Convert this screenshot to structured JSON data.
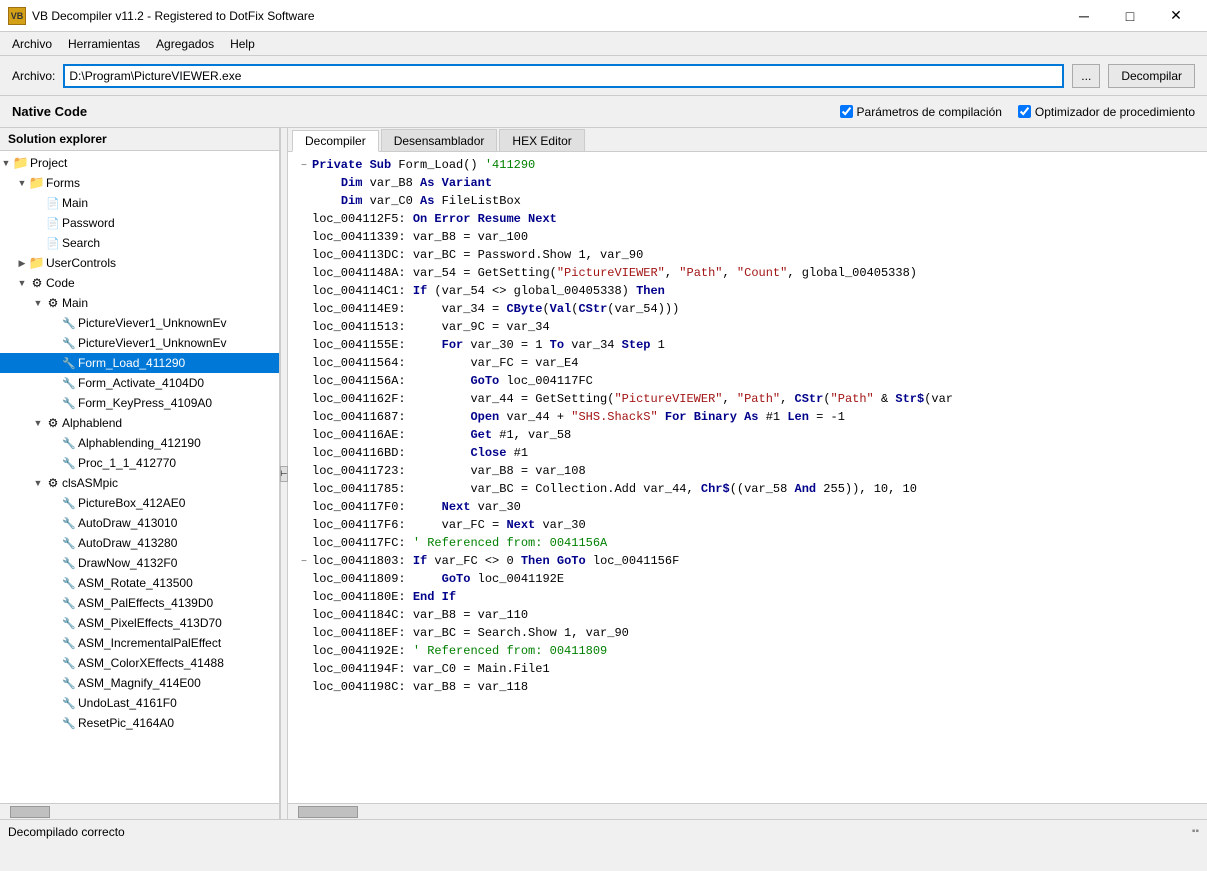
{
  "titlebar": {
    "icon_label": "VB",
    "title": "VB Decompiler v11.2 - Registered to DotFix Software",
    "minimize": "─",
    "maximize": "□",
    "close": "✕"
  },
  "menubar": {
    "items": [
      "Archivo",
      "Herramientas",
      "Agregados",
      "Help"
    ]
  },
  "toolbar": {
    "label": "Archivo:",
    "filepath": "D:\\Program\\PictureVIEWER.exe",
    "browse_label": "...",
    "decompile_label": "Decompilar"
  },
  "header": {
    "native_code": "Native Code",
    "checkbox1_label": "Parámetros de compilación",
    "checkbox2_label": "Optimizador de procedimiento"
  },
  "solution_explorer": {
    "title": "Solution explorer",
    "tree": [
      {
        "id": "project",
        "level": 0,
        "expanded": true,
        "icon": "📁",
        "label": "Project",
        "type": "folder"
      },
      {
        "id": "forms",
        "level": 1,
        "expanded": true,
        "icon": "📁",
        "label": "Forms",
        "type": "folder"
      },
      {
        "id": "main",
        "level": 2,
        "expanded": false,
        "icon": "📄",
        "label": "Main",
        "type": "file"
      },
      {
        "id": "password",
        "level": 2,
        "expanded": false,
        "icon": "📄",
        "label": "Password",
        "type": "file"
      },
      {
        "id": "search",
        "level": 2,
        "expanded": false,
        "icon": "📄",
        "label": "Search",
        "type": "file"
      },
      {
        "id": "usercontrols",
        "level": 1,
        "expanded": false,
        "icon": "📁",
        "label": "UserControls",
        "type": "folder"
      },
      {
        "id": "code",
        "level": 1,
        "expanded": true,
        "icon": "⚙",
        "label": "Code",
        "type": "code-folder"
      },
      {
        "id": "main2",
        "level": 2,
        "expanded": true,
        "icon": "⚙",
        "label": "Main",
        "type": "code-folder"
      },
      {
        "id": "picviewerunk1",
        "level": 3,
        "expanded": false,
        "icon": "🔧",
        "label": "PictureViever1_UnknownEv",
        "type": "method",
        "selected": false
      },
      {
        "id": "picviewerunk2",
        "level": 3,
        "expanded": false,
        "icon": "🔧",
        "label": "PictureViever1_UnknownEv",
        "type": "method",
        "selected": false
      },
      {
        "id": "formload",
        "level": 3,
        "expanded": false,
        "icon": "🔧",
        "label": "Form_Load_411290",
        "type": "method",
        "selected": true
      },
      {
        "id": "formactivate",
        "level": 3,
        "expanded": false,
        "icon": "🔧",
        "label": "Form_Activate_4104D0",
        "type": "method",
        "selected": false
      },
      {
        "id": "formkeypress",
        "level": 3,
        "expanded": false,
        "icon": "🔧",
        "label": "Form_KeyPress_4109A0",
        "type": "method",
        "selected": false
      },
      {
        "id": "alphablend",
        "level": 2,
        "expanded": true,
        "icon": "⚙",
        "label": "Alphablend",
        "type": "code-folder"
      },
      {
        "id": "alphablending",
        "level": 3,
        "expanded": false,
        "icon": "🔧",
        "label": "Alphablending_412190",
        "type": "method",
        "selected": false
      },
      {
        "id": "proc11",
        "level": 3,
        "expanded": false,
        "icon": "🔧",
        "label": "Proc_1_1_412770",
        "type": "method",
        "selected": false
      },
      {
        "id": "clsasmpic",
        "level": 2,
        "expanded": true,
        "icon": "⚙",
        "label": "clsASMpic",
        "type": "code-folder"
      },
      {
        "id": "picturebox",
        "level": 3,
        "expanded": false,
        "icon": "🔧",
        "label": "PictureBox_412AE0",
        "type": "method",
        "selected": false
      },
      {
        "id": "autodraw1",
        "level": 3,
        "expanded": false,
        "icon": "🔧",
        "label": "AutoDraw_413010",
        "type": "method",
        "selected": false
      },
      {
        "id": "autodraw2",
        "level": 3,
        "expanded": false,
        "icon": "🔧",
        "label": "AutoDraw_413280",
        "type": "method",
        "selected": false
      },
      {
        "id": "drawnow",
        "level": 3,
        "expanded": false,
        "icon": "🔧",
        "label": "DrawNow_4132F0",
        "type": "method",
        "selected": false
      },
      {
        "id": "asmrotate",
        "level": 3,
        "expanded": false,
        "icon": "🔧",
        "label": "ASM_Rotate_413500",
        "type": "method",
        "selected": false
      },
      {
        "id": "asmpaleffects",
        "level": 3,
        "expanded": false,
        "icon": "🔧",
        "label": "ASM_PalEffects_4139D0",
        "type": "method",
        "selected": false
      },
      {
        "id": "asmpixeleffects",
        "level": 3,
        "expanded": false,
        "icon": "🔧",
        "label": "ASM_PixelEffects_413D70",
        "type": "method",
        "selected": false
      },
      {
        "id": "asmincrementalpal",
        "level": 3,
        "expanded": false,
        "icon": "🔧",
        "label": "ASM_IncrementalPalEffect",
        "type": "method",
        "selected": false
      },
      {
        "id": "asmcolorx",
        "level": 3,
        "expanded": false,
        "icon": "🔧",
        "label": "ASM_ColorXEffects_41488",
        "type": "method",
        "selected": false
      },
      {
        "id": "asmmagnify",
        "level": 3,
        "expanded": false,
        "icon": "🔧",
        "label": "ASM_Magnify_414E00",
        "type": "method",
        "selected": false
      },
      {
        "id": "undolast",
        "level": 3,
        "expanded": false,
        "icon": "🔧",
        "label": "UndoLast_4161F0",
        "type": "method",
        "selected": false
      },
      {
        "id": "resetpic",
        "level": 3,
        "expanded": false,
        "icon": "🔧",
        "label": "ResetPic_4164A0",
        "type": "method",
        "selected": false
      }
    ]
  },
  "tabs": [
    {
      "id": "decompiler",
      "label": "Decompiler",
      "active": true
    },
    {
      "id": "desensamblador",
      "label": "Desensamblador",
      "active": false
    },
    {
      "id": "hex-editor",
      "label": "HEX Editor",
      "active": false
    }
  ],
  "code": {
    "lines": [
      {
        "collapse": "−",
        "loc": "",
        "code_html": "<span class='kw'>Private Sub</span> Form_Load() <span class='cmt'>'411290</span>"
      },
      {
        "collapse": "",
        "loc": "    ",
        "code_html": "<span class='kw'>Dim</span> var_B8 <span class='kw'>As Variant</span>"
      },
      {
        "collapse": "",
        "loc": "    ",
        "code_html": "<span class='kw'>Dim</span> var_C0 <span class='kw'>As</span> FileListBox"
      },
      {
        "collapse": "",
        "loc": "loc_004112F5: ",
        "code_html": "<span class='kw'>On Error Resume Next</span>"
      },
      {
        "collapse": "",
        "loc": "loc_00411339: ",
        "code_html": "var_B8 = var_100"
      },
      {
        "collapse": "",
        "loc": "loc_004113DC: ",
        "code_html": "var_BC = Password.Show 1, var_90"
      },
      {
        "collapse": "",
        "loc": "loc_0041148A: ",
        "code_html": "var_54 = GetSetting(<span class='str'>\"PictureVIEWER\"</span>, <span class='str'>\"Path\"</span>, <span class='str'>\"Count\"</span>, global_00405338)"
      },
      {
        "collapse": "",
        "loc": "loc_004114C1: ",
        "code_html": "<span class='kw'>If</span> (var_54 <> global_00405338) <span class='kw'>Then</span>"
      },
      {
        "collapse": "",
        "loc": "loc_004114E9:     ",
        "code_html": "var_34 = <span class='kw'>CByte</span>(<span class='kw'>Val</span>(<span class='kw'>CStr</span>(var_54)))"
      },
      {
        "collapse": "",
        "loc": "loc_00411513:     ",
        "code_html": "var_9C = var_34"
      },
      {
        "collapse": "",
        "loc": "loc_0041155E:     ",
        "code_html": "<span class='kw'>For</span> var_30 = 1 <span class='kw'>To</span> var_34 <span class='kw'>Step</span> 1"
      },
      {
        "collapse": "",
        "loc": "loc_00411564:         ",
        "code_html": "var_FC = var_E4"
      },
      {
        "collapse": "",
        "loc": "loc_0041156A:         ",
        "code_html": "<span class='kw'>GoTo</span> loc_004117FC"
      },
      {
        "collapse": "",
        "loc": "loc_0041162F:         ",
        "code_html": "var_44 = GetSetting(<span class='str'>\"PictureVIEWER\"</span>, <span class='str'>\"Path\"</span>, <span class='kw'>CStr</span>(<span class='str'>\"Path\"</span> &amp; <span class='kw'>Str$</span>(var"
      },
      {
        "collapse": "",
        "loc": "loc_00411687:         ",
        "code_html": "<span class='kw'>Open</span> var_44 + <span class='str'>\"SHS.ShackS\"</span> <span class='kw'>For Binary As</span> #1 <span class='kw'>Len</span> = -1"
      },
      {
        "collapse": "",
        "loc": "loc_004116AE:         ",
        "code_html": "<span class='kw'>Get</span> #1, var_58"
      },
      {
        "collapse": "",
        "loc": "loc_004116BD:         ",
        "code_html": "<span class='kw'>Close</span> #1"
      },
      {
        "collapse": "",
        "loc": "loc_00411723:         ",
        "code_html": "var_B8 = var_108"
      },
      {
        "collapse": "",
        "loc": "loc_00411785:         ",
        "code_html": "var_BC = Collection.Add var_44, <span class='kw'>Chr$</span>((var_58 <span class='kw'>And</span> 255)), 10, 10"
      },
      {
        "collapse": "",
        "loc": "loc_004117F0:     ",
        "code_html": "<span class='kw'>Next</span> var_30"
      },
      {
        "collapse": "",
        "loc": "loc_004117F6:     ",
        "code_html": "var_FC = <span class='kw'>Next</span> var_30"
      },
      {
        "collapse": "",
        "loc": "loc_004117FC: ",
        "code_html": "<span class='cmt'>' Referenced from: 0041156A</span>"
      },
      {
        "collapse": "−",
        "loc": "loc_00411803: ",
        "code_html": "<span class='kw'>If</span> var_FC <> 0 <span class='kw'>Then GoTo</span> loc_0041156F"
      },
      {
        "collapse": "",
        "loc": "loc_00411809:     ",
        "code_html": "<span class='kw'>GoTo</span> loc_0041192E"
      },
      {
        "collapse": "",
        "loc": "loc_0041180E: ",
        "code_html": "<span class='kw'>End If</span>"
      },
      {
        "collapse": "",
        "loc": "loc_0041184C: ",
        "code_html": "var_B8 = var_110"
      },
      {
        "collapse": "",
        "loc": "loc_004118EF: ",
        "code_html": "var_BC = Search.Show 1, var_90"
      },
      {
        "collapse": "",
        "loc": "loc_0041192E: ",
        "code_html": "<span class='cmt'>' Referenced from: 00411809</span>"
      },
      {
        "collapse": "",
        "loc": "loc_0041194F: ",
        "code_html": "var_C0 = Main.File1"
      },
      {
        "collapse": "",
        "loc": "loc_0041198C: ",
        "code_html": "var_B8 = var_118"
      }
    ]
  },
  "statusbar": {
    "text": "Decompilado correcto"
  }
}
